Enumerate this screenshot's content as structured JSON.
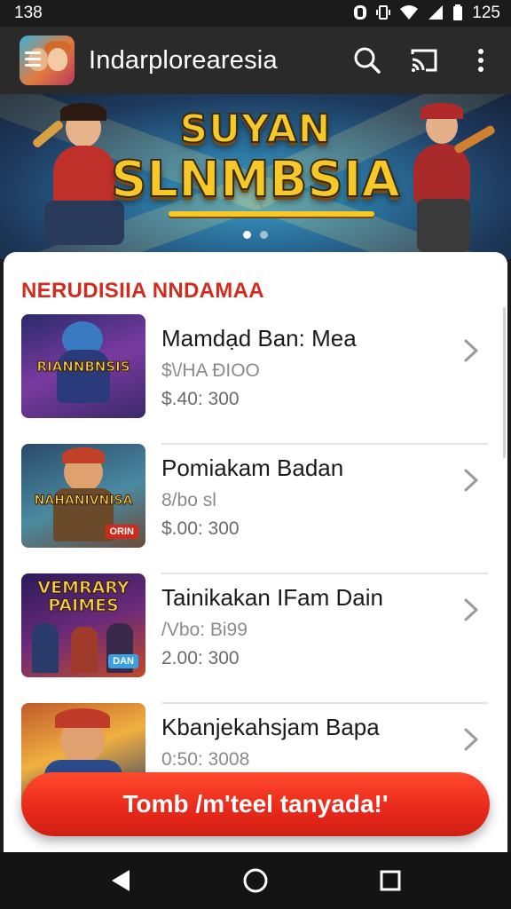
{
  "status_bar": {
    "time": "138",
    "clock": "125",
    "icons": [
      "nfc-icon",
      "vibrate-icon",
      "wifi-icon",
      "signal-icon",
      "battery-icon"
    ]
  },
  "app_bar": {
    "title": "Indarplorearesia",
    "actions": [
      "search-icon",
      "cast-icon",
      "more-vert-icon"
    ]
  },
  "banner": {
    "title_line1": "SUYAN",
    "title_line2": "SLNMBSIA",
    "page_count": 2,
    "active_page": 1
  },
  "section": {
    "title": "NERUDISIIA NNDAMAA"
  },
  "items": [
    {
      "name": "Mamdạd Ban: Mea",
      "sub": "$\\/HA ĐIOO",
      "price": "$.40: 300",
      "thumb_text": "RIANNBNSIS",
      "thumb_colors": [
        "#3a2a6a",
        "#7a3aa0",
        "#c47a2a"
      ]
    },
    {
      "name": "Pomiakam Badan",
      "sub": "8/bo sl",
      "price": "$.00: 300",
      "thumb_text": "NAHANIVNISA",
      "thumb_badge": "ORIN",
      "thumb_colors": [
        "#2a4a6a",
        "#4a8aa0",
        "#c0702a"
      ]
    },
    {
      "name": "Tainikakan IFam Dain",
      "sub": "/Vbo: Bi99",
      "price": "2.00: 300",
      "thumb_text": "VEMRARY\nPAIMES",
      "thumb_badge": "DAN",
      "thumb_colors": [
        "#2a1a5a",
        "#6a2a7a",
        "#c04a2a"
      ]
    },
    {
      "name": "Kbanjekahsjam Bapa",
      "sub": "",
      "price": "0:50: 3008",
      "thumb_text": "",
      "thumb_colors": [
        "#2a3a6a",
        "#c05a2a",
        "#f0b040"
      ]
    }
  ],
  "cta": {
    "label": "Tomb /m'teel tanyada!'"
  },
  "nav": [
    "back-icon",
    "home-icon",
    "recents-icon"
  ],
  "colors": {
    "accent_red": "#d32b1f",
    "cta_red": "#e8281a",
    "app_bar": "#2a2a2a",
    "banner_yellow": "#f6c928"
  }
}
